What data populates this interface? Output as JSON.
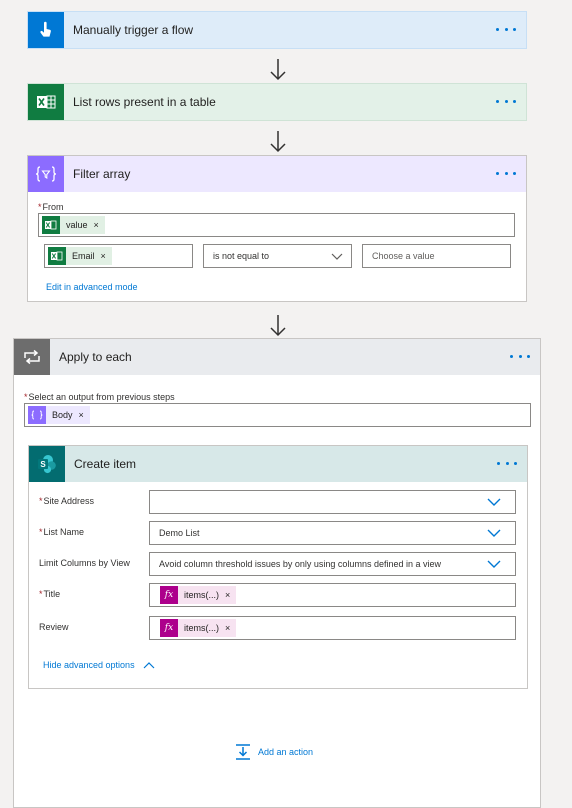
{
  "trigger": {
    "title": "Manually trigger a flow",
    "icon": "touch-hand-icon",
    "color": "#0078d4"
  },
  "list_rows": {
    "title": "List rows present in a table",
    "icon": "excel-icon",
    "color": "#107c41"
  },
  "filter": {
    "title": "Filter array",
    "icon": "filter-braces-icon",
    "color": "#8c6cff",
    "from_label": "From",
    "from_token": "value",
    "cond_left_token": "Email",
    "operator": "is not equal to",
    "value_placeholder": "Choose a value",
    "advanced_link": "Edit in advanced mode"
  },
  "apply_each": {
    "title": "Apply to each",
    "icon": "loop-icon",
    "color": "#6d6d6d",
    "select_label": "Select an output from previous steps",
    "body_token": "Body"
  },
  "create_item": {
    "title": "Create item",
    "icon": "sharepoint-icon",
    "color": "#036c70",
    "site_label": "Site Address",
    "site_value": "",
    "list_label": "List Name",
    "list_value": "Demo List",
    "limit_label": "Limit Columns by View",
    "limit_value": "Avoid column threshold issues by only using columns defined in a view",
    "title_label": "Title",
    "title_token": "items(...)",
    "review_label": "Review",
    "review_token": "items(...)",
    "hide_link": "Hide advanced options"
  },
  "add_action": "Add an action",
  "remove_glyph": "×"
}
